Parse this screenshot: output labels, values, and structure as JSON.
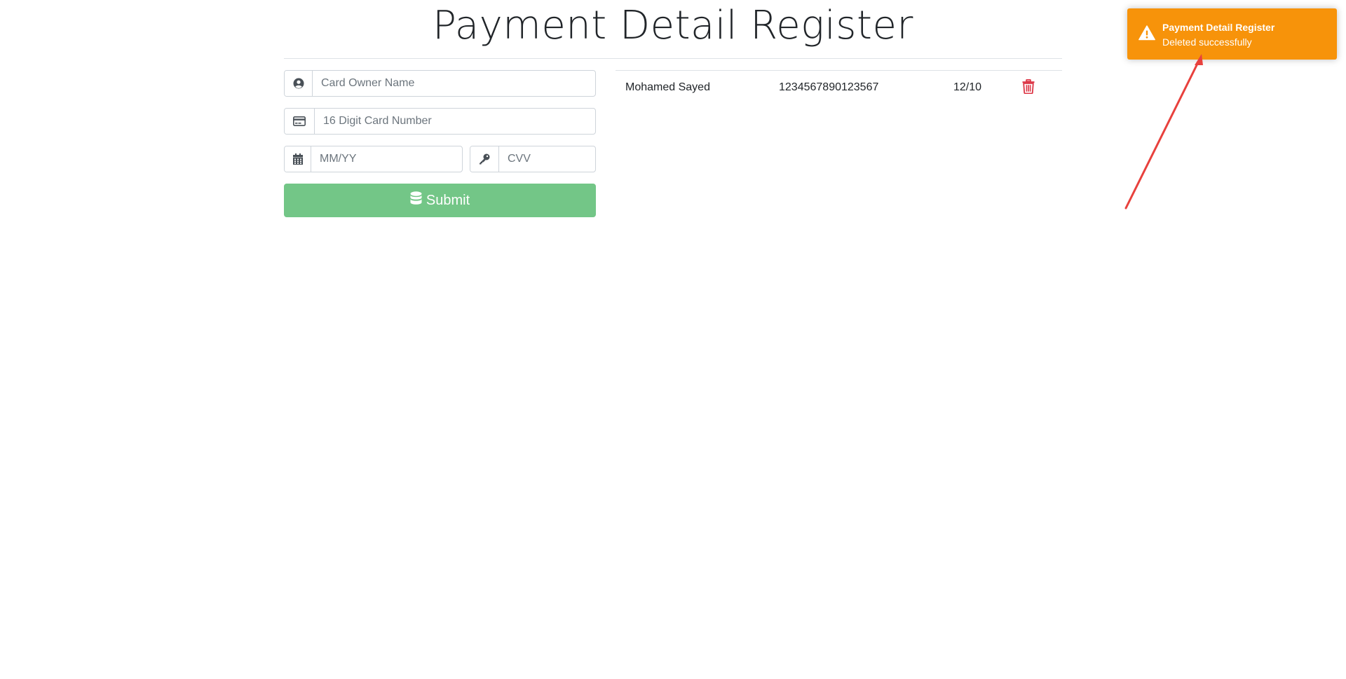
{
  "page": {
    "title": "Payment Detail Register"
  },
  "form": {
    "owner_placeholder": "Card Owner Name",
    "owner_value": "",
    "card_placeholder": "16 Digit Card Number",
    "card_value": "",
    "expiry_placeholder": "MM/YY",
    "expiry_value": "",
    "cvv_placeholder": "CVV",
    "cvv_value": "",
    "submit_label": "Submit",
    "submit_color": "#73c687"
  },
  "icons": {
    "owner": "user-circle-icon",
    "card": "credit-card-icon",
    "expiry": "calendar-icon",
    "cvv": "key-icon",
    "submit": "database-icon",
    "delete": "trash-icon",
    "toast": "warning-icon"
  },
  "records": [
    {
      "owner": "Mohamed Sayed",
      "card_number": "1234567890123567",
      "expiry": "12/10"
    }
  ],
  "toast": {
    "title": "Payment Detail Register",
    "message": "Deleted successfully",
    "color": "#f7930a"
  },
  "colors": {
    "delete": "#dc3545",
    "annotation_arrow": "#e8413d"
  }
}
